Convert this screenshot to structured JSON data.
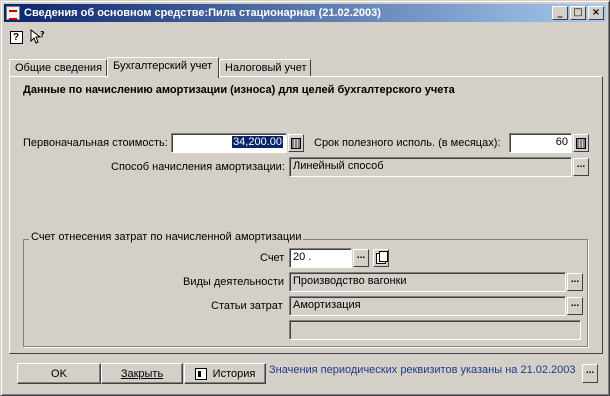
{
  "window": {
    "title": "Сведения об основном средстве:Пила стационарная (21.02.2003)",
    "buttons": {
      "minimize": "_",
      "maximize": "□",
      "close": "×"
    }
  },
  "toolbar": {
    "help_icon": "help-icon",
    "whatsthis_icon": "whats-this-icon"
  },
  "tabs": [
    "Общие сведения",
    "Бухгалтерский учет",
    "Налоговый учет"
  ],
  "active_tab": "Бухгалтерский учет",
  "section": {
    "heading": "Данные по начислению амортизации (износа) для целей бухгалтерского учета"
  },
  "form": {
    "initial_cost_label": "Первоначальная стоимость:",
    "initial_cost_value": "34,200.00",
    "useful_life_label": "Срок полезного исполь. (в месяцах):",
    "useful_life_value": "60",
    "method_label": "Способ начисления амортизации:",
    "method_value": "Линейный способ",
    "select_btn": "..."
  },
  "group": {
    "title": "Счет отнесения затрат по начисленной амортизации",
    "account_label": "Счет",
    "account_value": "20 .",
    "activity_label": "Виды деятельности",
    "activity_value": "Производство вагонки",
    "cost_item_label": "Статьи затрат",
    "cost_item_value": "Амортизация",
    "extra_value": ""
  },
  "footer": {
    "ok_label": "OK",
    "close_label": "Закрыть",
    "history_label": "История",
    "note": "Значения периодических реквизитов указаны на 21.02.2003",
    "more_btn": "..."
  },
  "colors": {
    "title_start": "#0a246a",
    "title_end": "#a6caf0",
    "face": "#d4d0c8",
    "note": "#1a3a8a"
  }
}
